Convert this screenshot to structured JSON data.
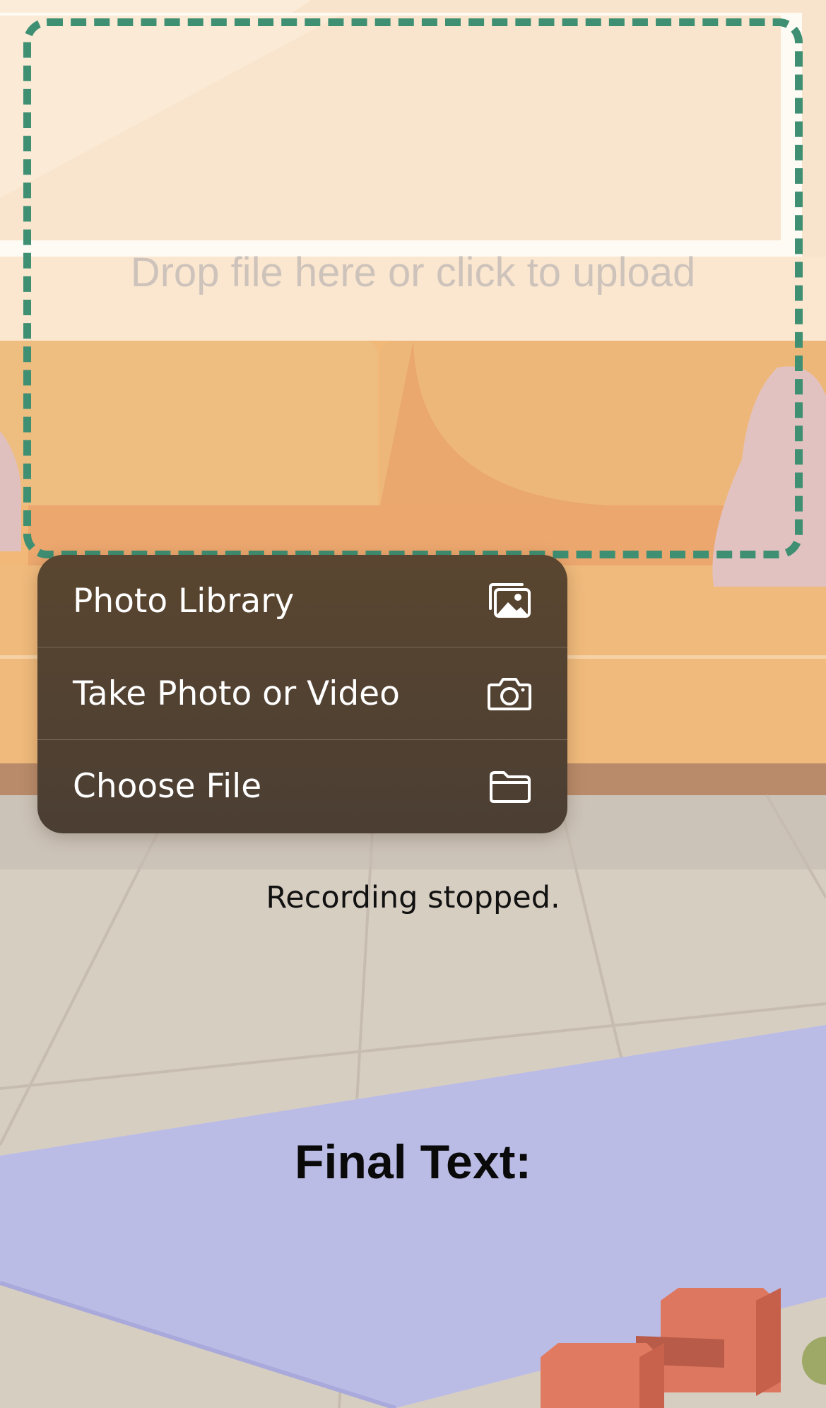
{
  "upload": {
    "placeholder": "Drop file here or click to upload"
  },
  "menu": {
    "items": [
      {
        "label": "Photo Library",
        "icon": "photo-library-icon"
      },
      {
        "label": "Take Photo or Video",
        "icon": "camera-icon"
      },
      {
        "label": "Choose File",
        "icon": "folder-icon"
      }
    ]
  },
  "status": {
    "text": "Recording stopped."
  },
  "output": {
    "title": "Final Text:"
  },
  "colors": {
    "dropzone_border": "#3f8f73",
    "menu_background": "#57452f",
    "wall": "#f8e4cc",
    "sofa": "#f0b673",
    "floor": "#d6ccc0",
    "mat": "#bcbbe6",
    "dumbbell": "#e07a60"
  }
}
